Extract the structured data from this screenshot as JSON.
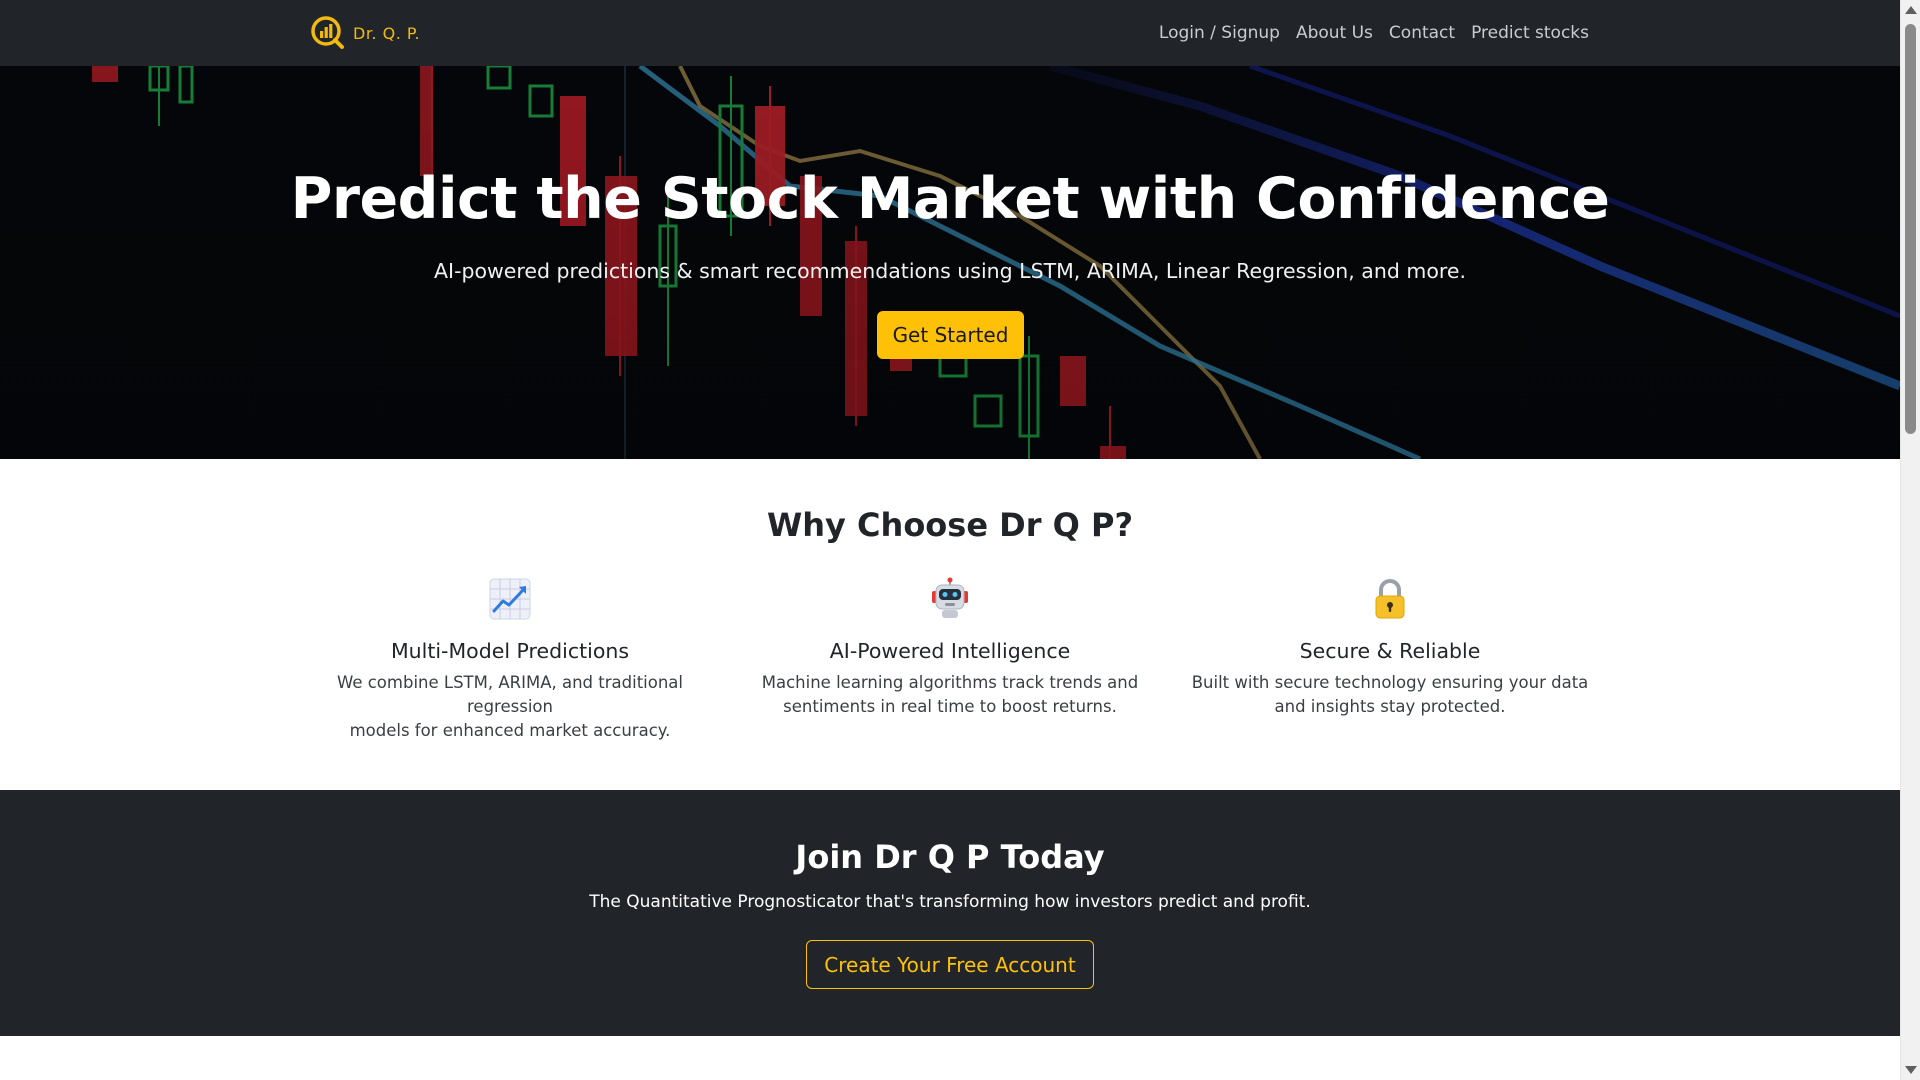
{
  "navbar": {
    "brand_name": "Dr. Q. P.",
    "brand_icon": "chart-magnifier-logo-icon",
    "links": [
      "Login / Signup",
      "About Us",
      "Contact",
      "Predict stocks"
    ]
  },
  "hero": {
    "title": "Predict the Stock Market with Confidence",
    "subtitle": "AI-powered predictions & smart recommendations using LSTM, ARIMA, Linear Regression, and more.",
    "cta_label": "Get Started"
  },
  "features": {
    "title": "Why Choose Dr Q P?",
    "items": [
      {
        "icon": "chart-increasing-icon",
        "title": "Multi-Model Predictions",
        "line1": "We combine LSTM, ARIMA, and traditional regression",
        "line2": "models for enhanced market accuracy."
      },
      {
        "icon": "robot-icon",
        "title": "AI-Powered Intelligence",
        "line1": "Machine learning algorithms track trends and",
        "line2": "sentiments in real time to boost returns."
      },
      {
        "icon": "lock-icon",
        "title": "Secure & Reliable",
        "line1": "Built with secure technology ensuring your data",
        "line2": "and insights stay protected."
      }
    ]
  },
  "join": {
    "title": "Join Dr Q P Today",
    "description": "The Quantitative Prognosticator that's transforming how investors predict and profit.",
    "cta_label": "Create Your Free Account"
  },
  "colors": {
    "accent": "#ffc107",
    "dark": "#212529",
    "brand": "#f2b90f"
  }
}
